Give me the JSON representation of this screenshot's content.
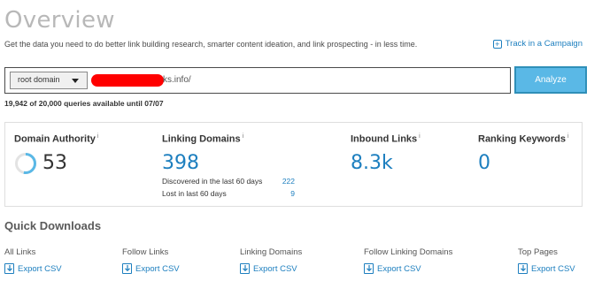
{
  "header": {
    "title": "Overview",
    "subtitle": "Get the data you need to do better link building research, smarter content ideation, and link prospecting - in less time.",
    "track_label": "Track in a Campaign"
  },
  "search": {
    "scope_selected": "root domain",
    "domain_visible": "ks.info/",
    "analyze_label": "Analyze"
  },
  "quota": {
    "text": "19,942 of 20,000 queries available until 07/07"
  },
  "metrics": {
    "domain_authority": {
      "label": "Domain Authority",
      "value": "53",
      "score": 53
    },
    "linking_domains": {
      "label": "Linking Domains",
      "value": "398",
      "discovered_label": "Discovered in the last 60 days",
      "discovered_value": "222",
      "lost_label": "Lost in last 60 days",
      "lost_value": "9"
    },
    "inbound_links": {
      "label": "Inbound Links",
      "value": "8.3k"
    },
    "ranking_keywords": {
      "label": "Ranking Keywords",
      "value": "0"
    },
    "info_marker": "i"
  },
  "quick_downloads": {
    "title": "Quick Downloads",
    "export_label": "Export CSV",
    "items": [
      {
        "label": "All Links"
      },
      {
        "label": "Follow Links"
      },
      {
        "label": "Linking Domains"
      },
      {
        "label": "Follow Linking Domains"
      },
      {
        "label": "Top Pages"
      }
    ]
  },
  "colors": {
    "accent": "#1d7fbf",
    "analyze_bg": "#5ab8e6",
    "title_gray": "#b8b8b8"
  }
}
